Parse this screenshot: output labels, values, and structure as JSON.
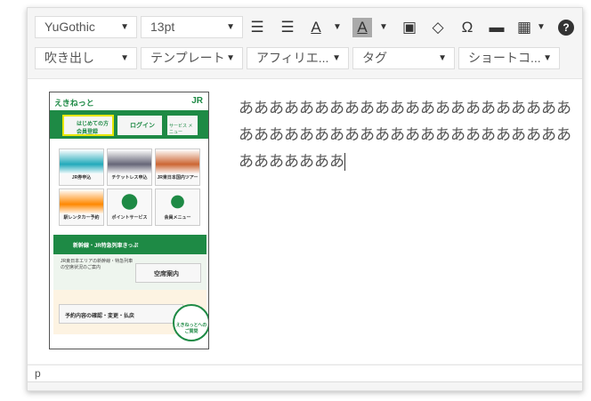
{
  "toolbar": {
    "row1": [
      {
        "label": "YuGothic"
      },
      {
        "label": "13pt"
      }
    ],
    "row2": [
      {
        "label": "吹き出し"
      },
      {
        "label": "テンプレート"
      },
      {
        "label": "アフィリエ..."
      },
      {
        "label": "タグ"
      },
      {
        "label": "ショートコ..."
      }
    ],
    "icons": [
      "outdent-icon",
      "indent-icon",
      "text-color-icon",
      "background-color-icon",
      "paste-as-text-icon",
      "clear-formatting-icon",
      "special-character-icon",
      "horizontal-line-icon",
      "table-icon",
      "help-icon"
    ],
    "text_color_glyph": "A",
    "omega_glyph": "Ω",
    "help_glyph": "?"
  },
  "image": {
    "logo": "えきねっと",
    "jr": "JR",
    "nav": [
      "はじめての方 会員登録",
      "ログイン",
      "サービス メニュー"
    ],
    "tiles": [
      "JR券申込",
      "チケットレス申込",
      "JR東日本国内ツアー",
      "駅レンタカー予約",
      "ポイントサービス",
      "会員メニュー"
    ],
    "section": "新幹線・JR特急列車きっぷ",
    "desc": "JR東日本エリアの新幹線・特急列車の空席状況のご案内",
    "seat_button": "空席案内",
    "reservation": "予約内容の確認・変更・払戻",
    "faq": "えきねっとへの ご質問",
    "accent": "#1e8a45"
  },
  "editor": {
    "lines": [
      "ああああああああああああああああああああああ",
      "ああああああああああああああああああああああ",
      "あああああああ"
    ]
  },
  "status": {
    "path": "p"
  }
}
